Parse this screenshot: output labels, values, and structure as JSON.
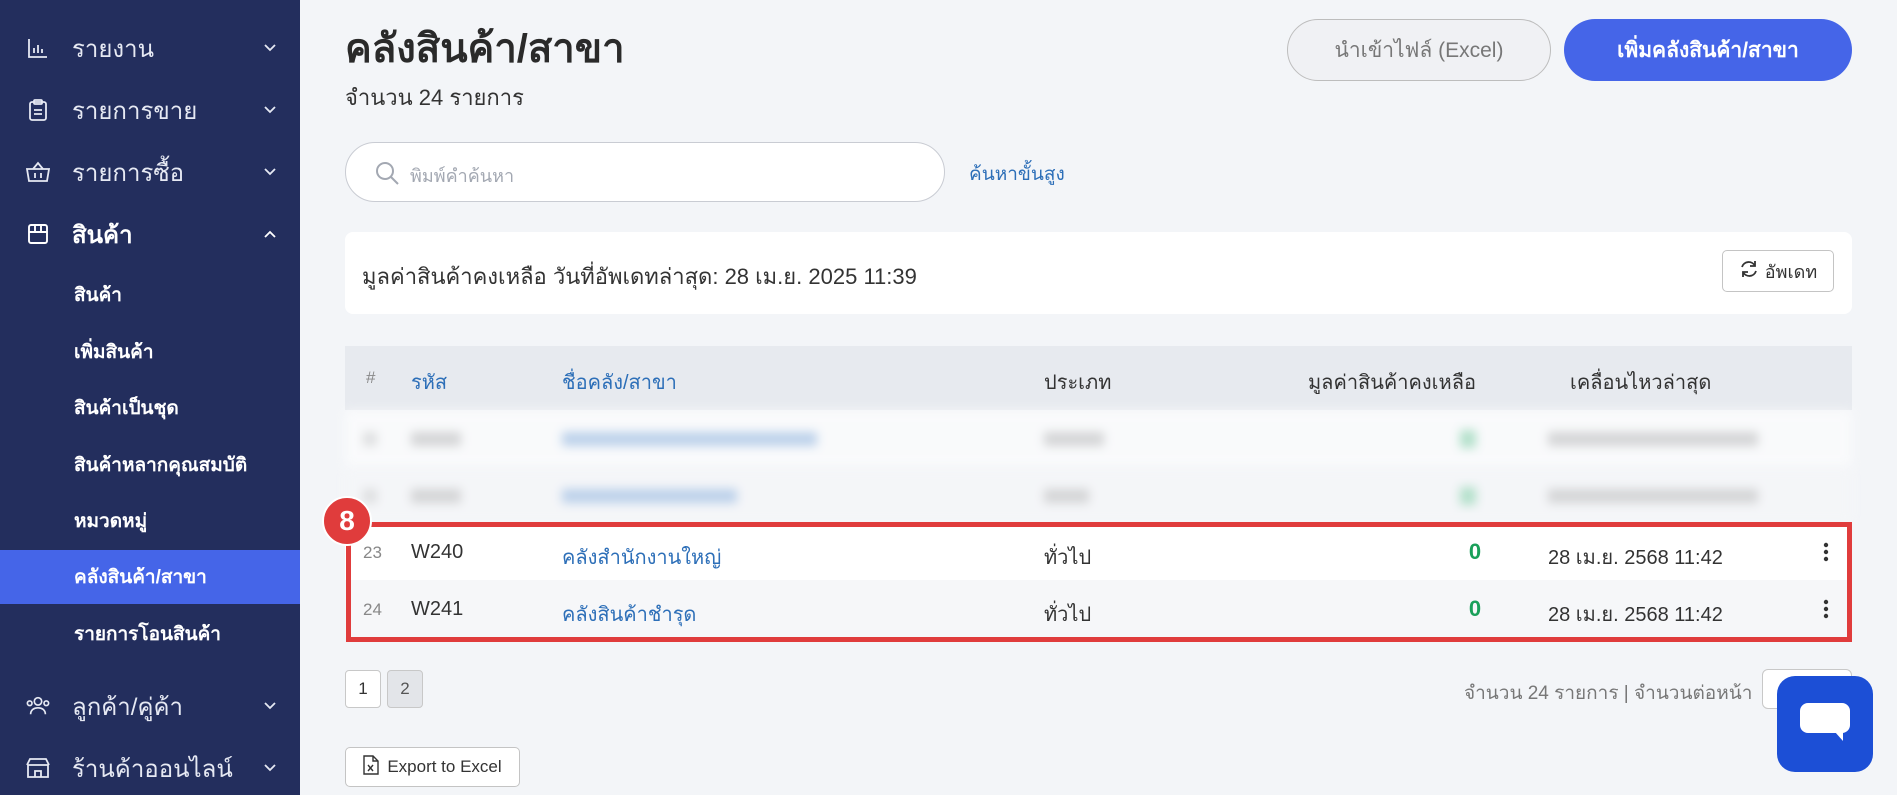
{
  "sidebar": {
    "main_items": [
      {
        "label": "รายงาน",
        "icon": "bar-chart-icon"
      },
      {
        "label": "รายการขาย",
        "icon": "clipboard-icon"
      },
      {
        "label": "รายการซื้อ",
        "icon": "basket-icon"
      },
      {
        "label": "สินค้า",
        "icon": "box-icon"
      },
      {
        "label": "ลูกค้า/คู่ค้า",
        "icon": "users-icon"
      },
      {
        "label": "ร้านค้าออนไลน์",
        "icon": "store-icon"
      }
    ],
    "sub_items": [
      {
        "label": "สินค้า"
      },
      {
        "label": "เพิ่มสินค้า"
      },
      {
        "label": "สินค้าเป็นชุด"
      },
      {
        "label": "สินค้าหลากคุณสมบัติ"
      },
      {
        "label": "หมวดหมู่"
      },
      {
        "label": "คลังสินค้า/สาขา"
      },
      {
        "label": "รายการโอนสินค้า"
      }
    ],
    "active_sub": "คลังสินค้า/สาขา",
    "colors": {
      "bg": "#232e5d",
      "active": "#4565e8"
    }
  },
  "header": {
    "title": "คลังสินค้า/สาขา",
    "count_text": "จำนวน 24 รายการ",
    "import_button": "นำเข้าไฟล์ (Excel)",
    "add_button": "เพิ่มคลังสินค้า/สาขา"
  },
  "search": {
    "placeholder": "พิมพ์คำค้นหา",
    "advanced_link": "ค้นหาขั้นสูง"
  },
  "summary": {
    "text": "มูลค่าสินค้าคงเหลือ วันที่อัพเดทล่าสุด: 28 เม.ย. 2025 11:39",
    "update_button": "อัพเดท"
  },
  "table": {
    "columns": {
      "num": "#",
      "code": "รหัส",
      "name": "ชื่อคลัง/สาขา",
      "type": "ประเภท",
      "value": "มูลค่าสินค้าคงเหลือ",
      "moved": "เคลื่อนไหวล่าสุด"
    },
    "rows": [
      {
        "num": "23",
        "code": "W240",
        "name": "คลังสำนักงานใหญ่",
        "type": "ทั่วไป",
        "value": "0",
        "moved": "28 เม.ย. 2568 11:42"
      },
      {
        "num": "24",
        "code": "W241",
        "name": "คลังสินค้าชำรุด",
        "type": "ทั่วไป",
        "value": "0",
        "moved": "28 เม.ย. 2568 11:42"
      }
    ],
    "highlight_badge": "8"
  },
  "pagination": {
    "pages": [
      "1",
      "2"
    ],
    "current": "2",
    "info": "จำนวน 24 รายการ | จำนวนต่อหน้า"
  },
  "export_button": "Export to Excel",
  "colors": {
    "primary": "#4565e8",
    "link": "#2d6fb8",
    "value_green": "#1aa05a",
    "highlight": "#e03c3c",
    "chat": "#1c4fd6"
  }
}
